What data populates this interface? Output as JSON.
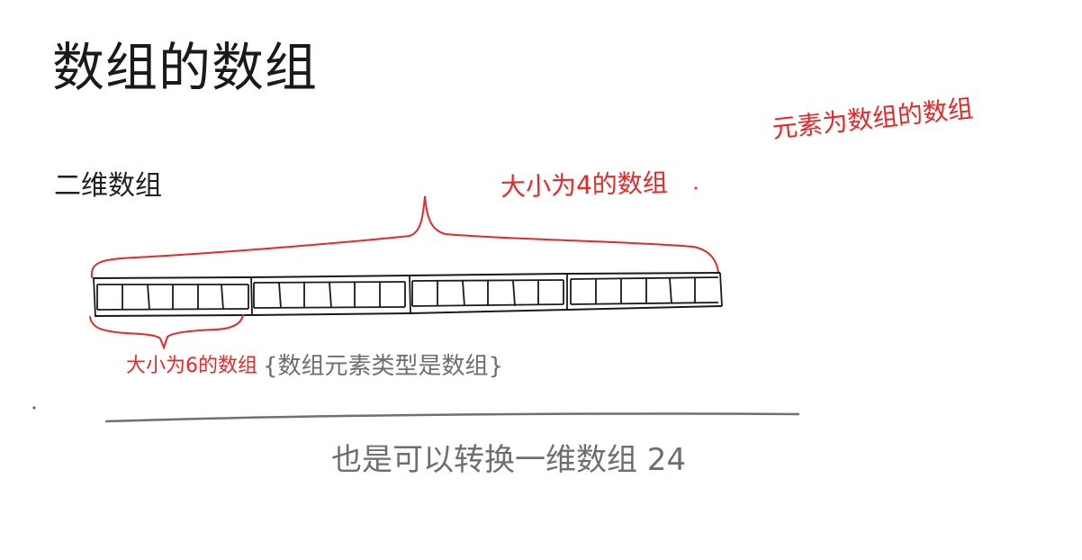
{
  "slide": {
    "title": "数组的数组"
  },
  "annotations": {
    "two_d_array": "二维数组",
    "outer_array": "大小为4的数组",
    "element_type": "元素为数组的数组",
    "inner_array": "大小为6的数组",
    "inner_type": "{数组元素类型是数组}",
    "convert": "也是可以转换一维数组 24"
  },
  "diagram": {
    "groups": 4,
    "cells_per_group": 6,
    "box_color": "#1a1a1a",
    "bracket_color": "#e32a2a",
    "divider_color": "#707070"
  }
}
